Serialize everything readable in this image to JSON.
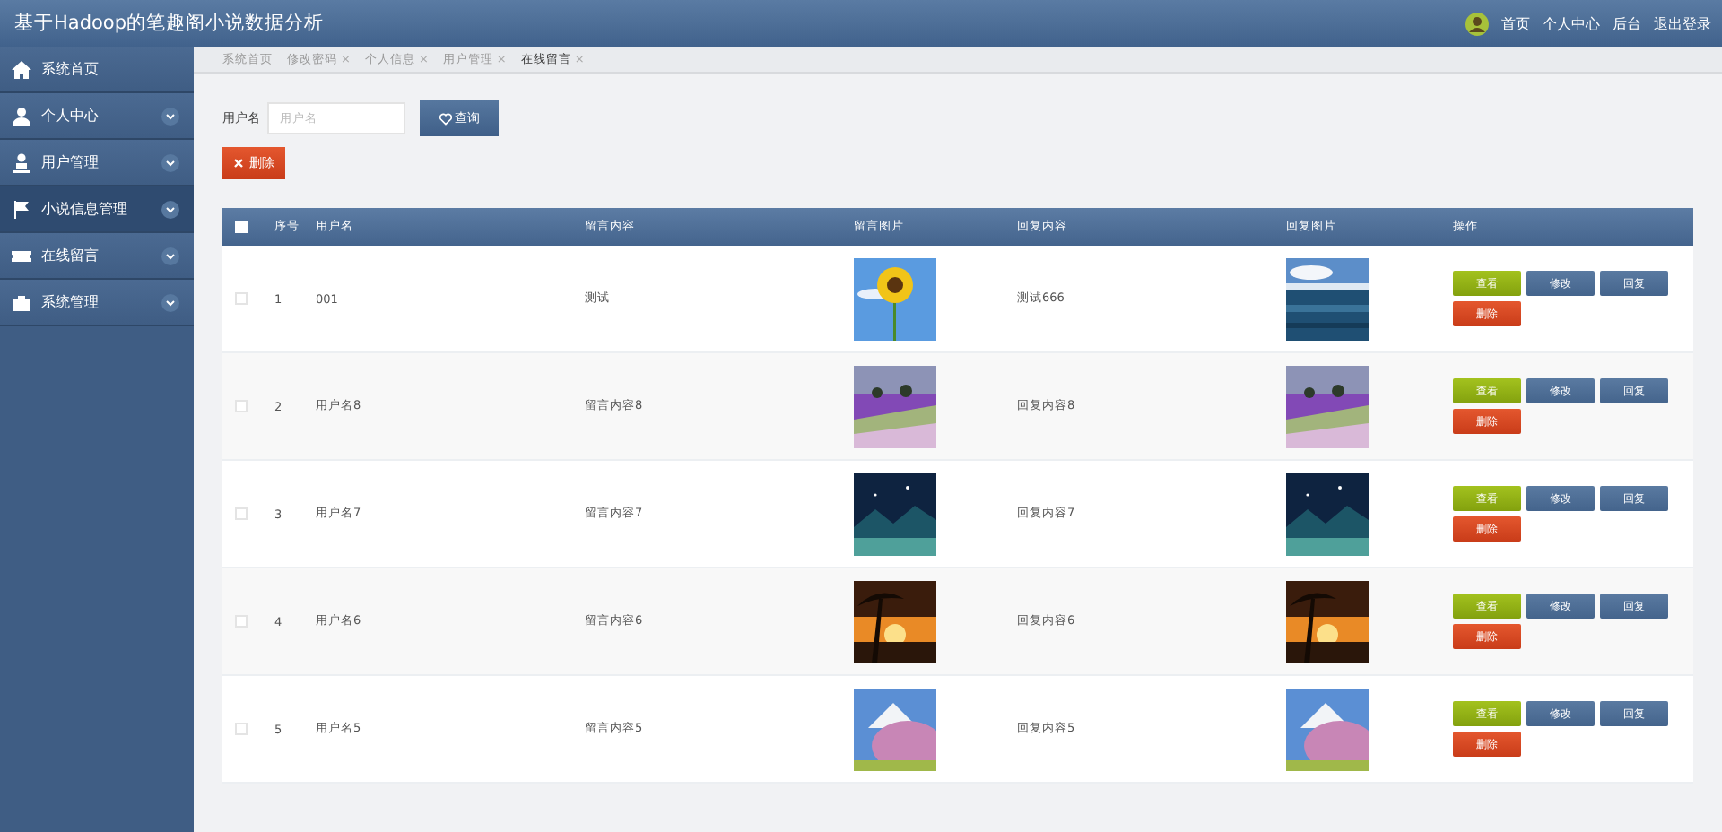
{
  "header": {
    "title": "基于Hadoop的笔趣阁小说数据分析",
    "links": [
      "首页",
      "个人中心",
      "后台",
      "退出登录"
    ]
  },
  "sidebar": {
    "items": [
      {
        "label": "系统首页",
        "kind": "home",
        "expandable": false,
        "selected": false
      },
      {
        "label": "个人中心",
        "kind": "user",
        "expandable": true,
        "selected": false
      },
      {
        "label": "用户管理",
        "kind": "staff",
        "expandable": true,
        "selected": false
      },
      {
        "label": "小说信息管理",
        "kind": "flag",
        "expandable": true,
        "selected": true
      },
      {
        "label": "在线留言",
        "kind": "ticket",
        "expandable": true,
        "selected": false
      },
      {
        "label": "系统管理",
        "kind": "case",
        "expandable": true,
        "selected": false
      }
    ]
  },
  "tabs": [
    {
      "label": "系统首页",
      "selected": false
    },
    {
      "label": "修改密码",
      "close": "×",
      "selected": false
    },
    {
      "label": "个人信息",
      "close": "×",
      "selected": false
    },
    {
      "label": "用户管理",
      "close": "×",
      "selected": false
    },
    {
      "label": "在线留言",
      "close": "×",
      "selected": true
    }
  ],
  "search": {
    "label": "用户名",
    "placeholder": "用户名",
    "button": "查询"
  },
  "delete_button": "删除",
  "table": {
    "all_checked": false,
    "columns": [
      "序号",
      "用户名",
      "留言内容",
      "留言图片",
      "回复内容",
      "回复图片",
      "操作"
    ],
    "rows": [
      {
        "checked": false,
        "index": "1",
        "user": "001",
        "message": "测试",
        "reply": "测试666",
        "actions": [
          "查看",
          "修改",
          "回复",
          "删除"
        ]
      },
      {
        "checked": false,
        "index": "2",
        "user": "用户名8",
        "message": "留言内容8",
        "reply": "回复内容8",
        "actions": [
          "查看",
          "修改",
          "回复",
          "删除"
        ]
      },
      {
        "checked": false,
        "index": "3",
        "user": "用户名7",
        "message": "留言内容7",
        "reply": "回复内容7",
        "actions": [
          "查看",
          "修改",
          "回复",
          "删除"
        ]
      },
      {
        "checked": false,
        "index": "4",
        "user": "用户名6",
        "message": "留言内容6",
        "reply": "回复内容6",
        "actions": [
          "查看",
          "修改",
          "回复",
          "删除"
        ]
      },
      {
        "checked": false,
        "index": "5",
        "user": "用户名5",
        "message": "留言内容5",
        "reply": "回复内容5",
        "actions": [
          "查看",
          "修改",
          "回复",
          "删除"
        ]
      }
    ]
  }
}
